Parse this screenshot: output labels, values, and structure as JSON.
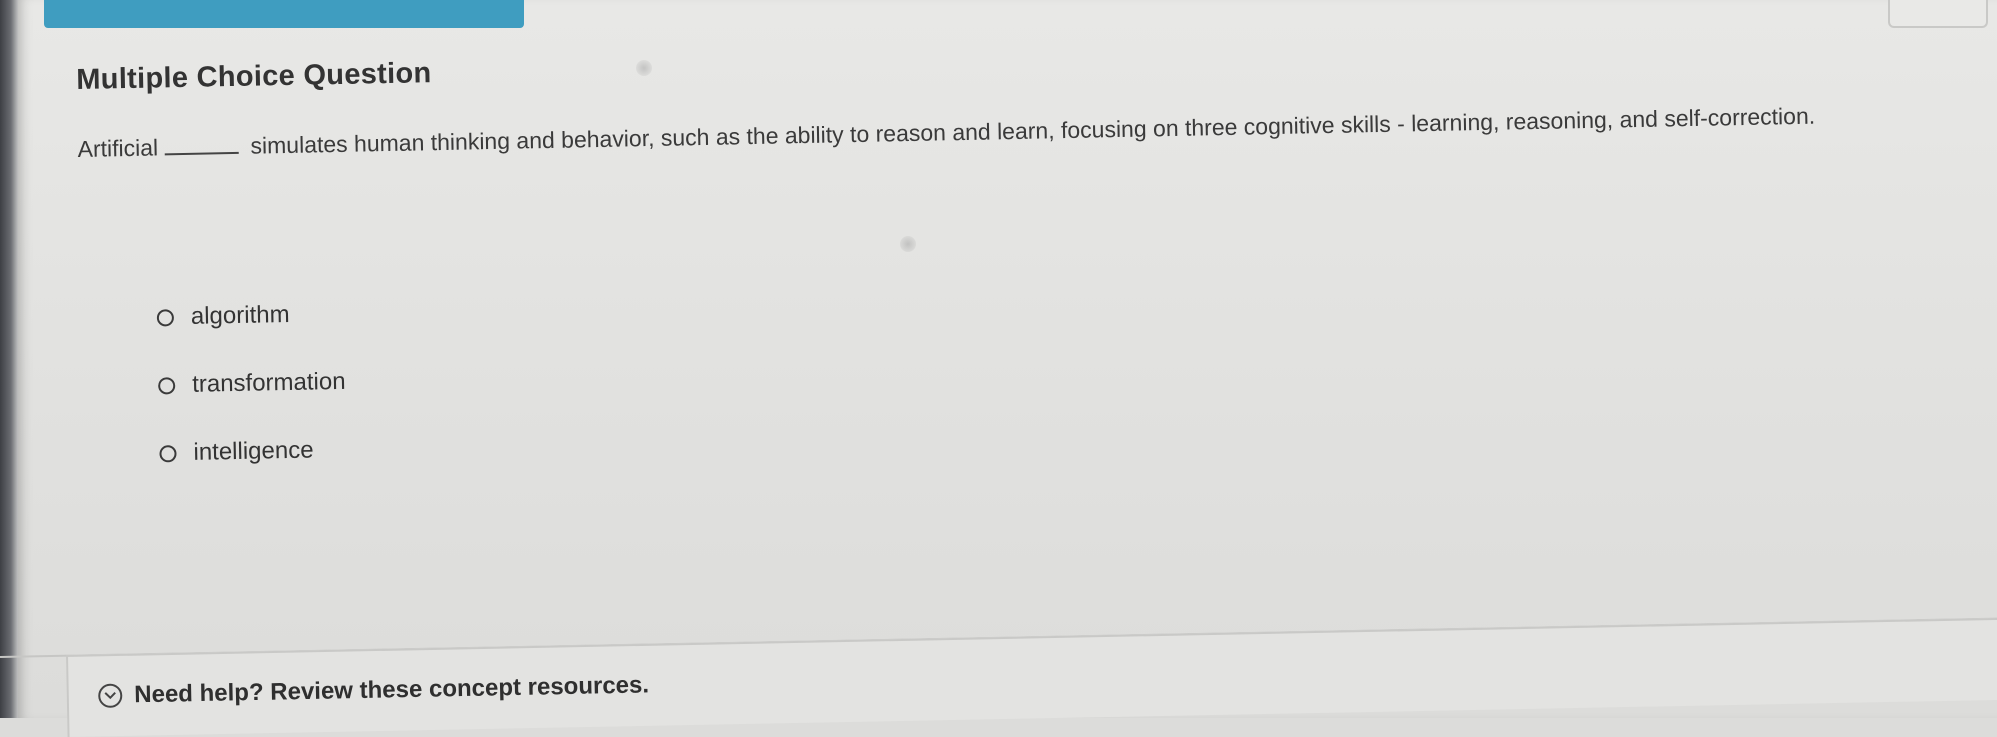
{
  "question": {
    "heading": "Multiple Choice Question",
    "prefix": "Artificial",
    "body": "simulates human thinking and behavior, such as the ability to reason and learn, focusing on three cognitive skills - learning, reasoning, and self-correction."
  },
  "options": [
    {
      "label": "algorithm",
      "selected": false
    },
    {
      "label": "transformation",
      "selected": false
    },
    {
      "label": "intelligence",
      "selected": false
    }
  ],
  "help": {
    "label": "Need help? Review these concept resources."
  },
  "colors": {
    "top_bar": "#3f9dc0",
    "background": "#e4e4e2",
    "text": "#333333"
  },
  "icons": {
    "help": "chevron-down-circle-icon",
    "option": "radio-icon"
  }
}
